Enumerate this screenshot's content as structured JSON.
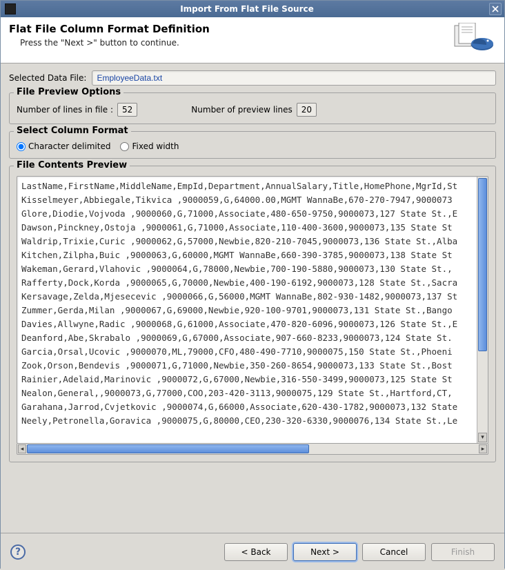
{
  "window": {
    "title": "Import From Flat File Source"
  },
  "header": {
    "title": "Flat File Column Format Definition",
    "subtitle": "Press the \"Next >\" button to continue."
  },
  "selected_file": {
    "label": "Selected Data File:",
    "value": "EmployeeData.txt"
  },
  "preview_options": {
    "legend": "File Preview Options",
    "lines_label": "Number of lines in file :",
    "lines_value": "52",
    "preview_label": "Number of preview lines",
    "preview_value": "20"
  },
  "column_format": {
    "legend": "Select Column Format",
    "options": [
      "Character delimited",
      "Fixed width"
    ],
    "selected_index": 0
  },
  "preview": {
    "legend": "File Contents Preview",
    "lines": [
      "LastName,FirstName,MiddleName,EmpId,Department,AnnualSalary,Title,HomePhone,MgrId,St",
      "Kisselmeyer,Abbiegale,Tikvica ,9000059,G,64000.00,MGMT WannaBe,670-270-7947,9000073",
      "Glore,Diodie,Vojvoda ,9000060,G,71000,Associate,480-650-9750,9000073,127 State St.,E",
      "Dawson,Pinckney,Ostoja ,9000061,G,71000,Associate,110-400-3600,9000073,135 State St",
      "Waldrip,Trixie,Curic ,9000062,G,57000,Newbie,820-210-7045,9000073,136 State St.,Alba",
      "Kitchen,Zilpha,Buic ,9000063,G,60000,MGMT WannaBe,660-390-3785,9000073,138 State St",
      "Wakeman,Gerard,Vlahovic ,9000064,G,78000,Newbie,700-190-5880,9000073,130 State St.,",
      "Rafferty,Dock,Korda ,9000065,G,70000,Newbie,400-190-6192,9000073,128 State St.,Sacra",
      "Kersavage,Zelda,Mjesecevic ,9000066,G,56000,MGMT WannaBe,802-930-1482,9000073,137 St",
      "Zummer,Gerda,Milan ,9000067,G,69000,Newbie,920-100-9701,9000073,131 State St.,Bango",
      "Davies,Allwyne,Radic ,9000068,G,61000,Associate,470-820-6096,9000073,126 State St.,E",
      "Deanford,Abe,Skrabalo ,9000069,G,67000,Associate,907-660-8233,9000073,124 State St.",
      "Garcia,Orsal,Ucovic ,9000070,ML,79000,CFO,480-490-7710,9000075,150 State St.,Phoeni",
      "Zook,Orson,Bendevis ,9000071,G,71000,Newbie,350-260-8654,9000073,133 State St.,Bost",
      "Rainier,Adelaid,Marinovic ,9000072,G,67000,Newbie,316-550-3499,9000073,125 State St",
      "Nealon,General,,9000073,G,77000,COO,203-420-3113,9000075,129 State St.,Hartford,CT,",
      "Garahana,Jarrod,Cvjetkovic ,9000074,G,66000,Associate,620-430-1782,9000073,132 State",
      "Neely,Petronella,Goravica ,9000075,G,80000,CEO,230-320-6330,9000076,134 State St.,Le"
    ]
  },
  "footer": {
    "back": "< Back",
    "next": "Next >",
    "cancel": "Cancel",
    "finish": "Finish"
  }
}
